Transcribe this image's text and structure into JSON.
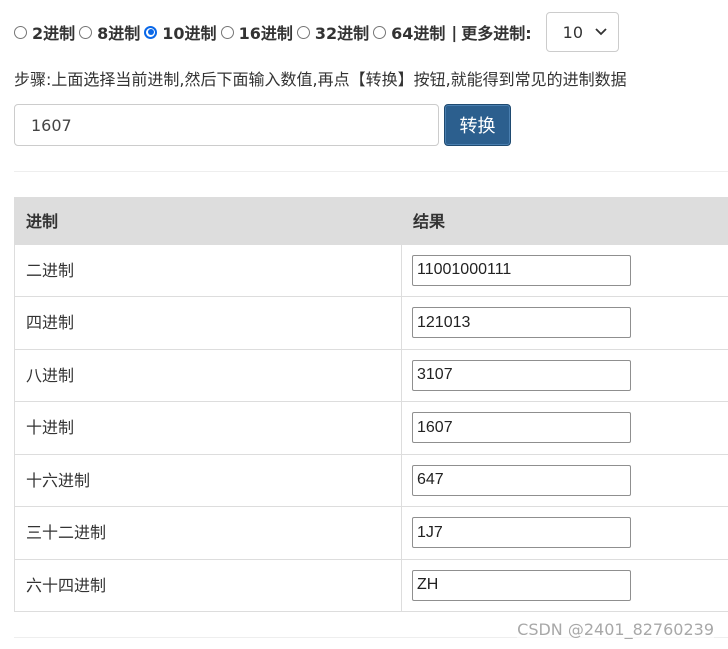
{
  "radix_options": [
    {
      "label": "2进制",
      "checked": false
    },
    {
      "label": "8进制",
      "checked": false
    },
    {
      "label": "10进制",
      "checked": true
    },
    {
      "label": "16进制",
      "checked": false
    },
    {
      "label": "32进制",
      "checked": false
    },
    {
      "label": "64进制",
      "checked": false
    }
  ],
  "separator": "|",
  "more_label": "更多进制:",
  "more_select": {
    "value": "10"
  },
  "steps_text": "步骤:上面选择当前进制,然后下面输入数值,再点【转换】按钮,就能得到常见的进制数据",
  "input": {
    "value": "1607"
  },
  "convert_label": "转换",
  "table": {
    "headers": [
      "进制",
      "结果"
    ],
    "rows": [
      {
        "name": "二进制",
        "value": "11001000111"
      },
      {
        "name": "四进制",
        "value": "121013"
      },
      {
        "name": "八进制",
        "value": "3107"
      },
      {
        "name": "十进制",
        "value": "1607"
      },
      {
        "name": "十六进制",
        "value": "647"
      },
      {
        "name": "三十二进制",
        "value": "1J7"
      },
      {
        "name": "六十四进制",
        "value": "ZH"
      }
    ]
  },
  "watermark": "CSDN @2401_82760239",
  "colors": {
    "accent": "#0a68e8",
    "button": "#2c5f8e",
    "header_bg": "#dddddd"
  }
}
